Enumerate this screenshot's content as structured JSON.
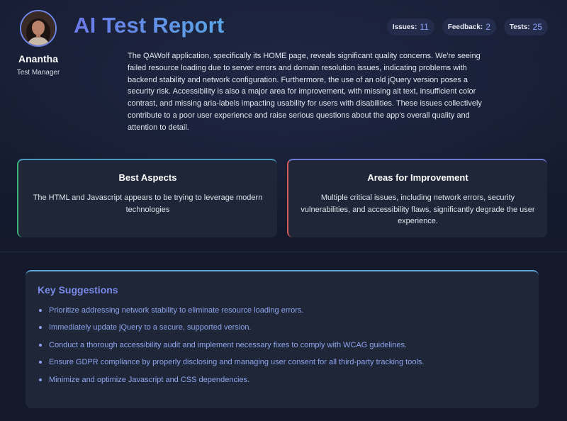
{
  "user": {
    "name": "Anantha",
    "role": "Test Manager"
  },
  "header": {
    "title": "AI Test Report"
  },
  "stats": [
    {
      "label": "Issues:",
      "value": "11"
    },
    {
      "label": "Feedback:",
      "value": "2"
    },
    {
      "label": "Tests:",
      "value": "25"
    }
  ],
  "summary": "The QAWolf application, specifically its HOME page, reveals significant quality concerns. We're seeing failed resource loading due to server errors and domain resolution issues, indicating problems with backend stability and network configuration. Furthermore, the use of an old jQuery version poses a security risk. Accessibility is also a major area for improvement, with missing alt text, insufficient color contrast, and missing aria-labels impacting usability for users with disabilities. These issues collectively contribute to a poor user experience and raise serious questions about the app's overall quality and attention to detail.",
  "best_aspects": {
    "title": "Best Aspects",
    "text": "The HTML and Javascript appears to be trying to leverage modern technologies"
  },
  "areas_for_improvement": {
    "title": "Areas for Improvement",
    "text": "Multiple critical issues, including network errors, security vulnerabilities, and accessibility flaws, significantly degrade the user experience."
  },
  "key_suggestions": {
    "title": "Key Suggestions",
    "items": [
      "Prioritize addressing network stability to eliminate resource loading errors.",
      "Immediately update jQuery to a secure, supported version.",
      "Conduct a thorough accessibility audit and implement necessary fixes to comply with WCAG guidelines.",
      "Ensure GDPR compliance by properly disclosing and managing user consent for all third-party tracking tools.",
      "Minimize and optimize Javascript and CSS dependencies."
    ]
  },
  "colors": {
    "background": "#141a2c",
    "card": "#1f2637",
    "accent_blue": "#6b79e8",
    "best_border": "#3fb37a",
    "improve_border": "#d65a5a"
  },
  "icons": {
    "avatar": "user-avatar-photo"
  }
}
